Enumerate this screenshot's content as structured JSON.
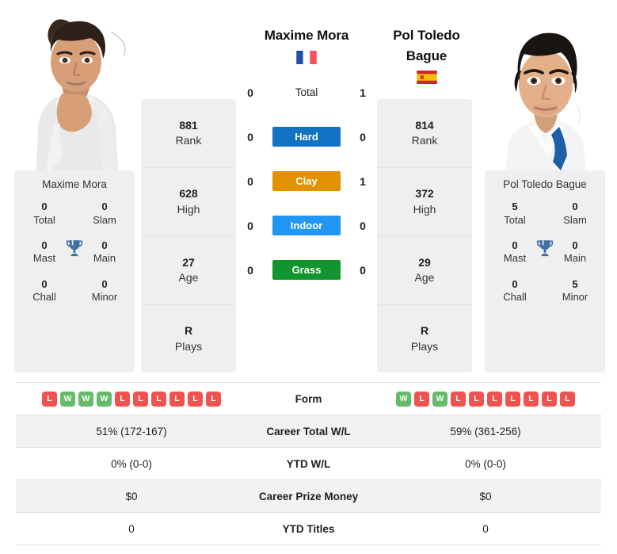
{
  "colors": {
    "hard": "#1273c4",
    "clay": "#e29100",
    "indoor": "#2196f3",
    "grass": "#12952f",
    "win": "#ef5350",
    "loss": "#66bb6a",
    "panel": "#efefef",
    "trophy": "#3d6fa5"
  },
  "players": {
    "left": {
      "name": "Maxime Mora",
      "country": "france",
      "photo_alt": "Maxime Mora photo",
      "panel_name": "Maxime Mora",
      "stats": [
        {
          "value": "881",
          "label": "Rank"
        },
        {
          "value": "628",
          "label": "High"
        },
        {
          "value": "27",
          "label": "Age"
        },
        {
          "value": "R",
          "label": "Plays"
        }
      ],
      "titles": [
        {
          "value": "0",
          "label": "Total"
        },
        {
          "value": "0",
          "label": "Slam"
        },
        {
          "value": "0",
          "label": "Mast"
        },
        {
          "value": "0",
          "label": "Main"
        },
        {
          "value": "0",
          "label": "Chall"
        },
        {
          "value": "0",
          "label": "Minor"
        }
      ],
      "form": [
        "L",
        "W",
        "W",
        "W",
        "L",
        "L",
        "L",
        "L",
        "L",
        "L"
      ],
      "career_wl": "51% (172-167)",
      "ytd_wl": "0% (0-0)",
      "prize_money": "$0",
      "ytd_titles": "0"
    },
    "right": {
      "name": "Pol Toledo Bague",
      "name_line1": "Pol Toledo",
      "name_line2": "Bague",
      "country": "spain",
      "photo_alt": "Pol Toledo Bague photo",
      "panel_name": "Pol Toledo Bague",
      "stats": [
        {
          "value": "814",
          "label": "Rank"
        },
        {
          "value": "372",
          "label": "High"
        },
        {
          "value": "29",
          "label": "Age"
        },
        {
          "value": "R",
          "label": "Plays"
        }
      ],
      "titles": [
        {
          "value": "5",
          "label": "Total"
        },
        {
          "value": "0",
          "label": "Slam"
        },
        {
          "value": "0",
          "label": "Mast"
        },
        {
          "value": "0",
          "label": "Main"
        },
        {
          "value": "0",
          "label": "Chall"
        },
        {
          "value": "5",
          "label": "Minor"
        }
      ],
      "form": [
        "W",
        "L",
        "W",
        "L",
        "L",
        "L",
        "L",
        "L",
        "L",
        "L"
      ],
      "career_wl": "59% (361-256)",
      "ytd_wl": "0% (0-0)",
      "prize_money": "$0",
      "ytd_titles": "0"
    }
  },
  "head_to_head": [
    {
      "key": "total",
      "label": "Total",
      "left": "0",
      "right": "1",
      "badge": false
    },
    {
      "key": "hard",
      "label": "Hard",
      "left": "0",
      "right": "0",
      "badge": true,
      "color": "#1273c4"
    },
    {
      "key": "clay",
      "label": "Clay",
      "left": "0",
      "right": "1",
      "badge": true,
      "color": "#e29100"
    },
    {
      "key": "indoor",
      "label": "Indoor",
      "left": "0",
      "right": "0",
      "badge": true,
      "color": "#2196f3"
    },
    {
      "key": "grass",
      "label": "Grass",
      "left": "0",
      "right": "0",
      "badge": true,
      "color": "#12952f"
    }
  ],
  "table": {
    "rows": [
      {
        "key": "form",
        "label": "Form",
        "type": "form",
        "shade": false
      },
      {
        "key": "career_wl",
        "label": "Career Total W/L",
        "type": "text",
        "shade": true,
        "left": "51% (172-167)",
        "right": "59% (361-256)"
      },
      {
        "key": "ytd_wl",
        "label": "YTD W/L",
        "type": "text",
        "shade": false,
        "left": "0% (0-0)",
        "right": "0% (0-0)"
      },
      {
        "key": "prize_money",
        "label": "Career Prize Money",
        "type": "text",
        "shade": true,
        "left": "$0",
        "right": "$0"
      },
      {
        "key": "ytd_titles",
        "label": "YTD Titles",
        "type": "text",
        "shade": false,
        "left": "0",
        "right": "0"
      }
    ]
  }
}
